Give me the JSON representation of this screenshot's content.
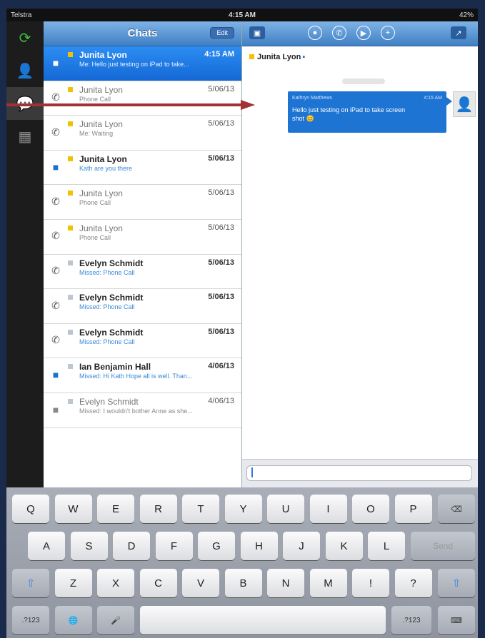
{
  "status": {
    "carrier": "Telstra",
    "time": "4:15 AM",
    "battery": "42%"
  },
  "rail": [
    {
      "name": "sync-icon",
      "glyph": "⟳"
    },
    {
      "name": "contacts-icon",
      "glyph": "👤"
    },
    {
      "name": "chats-icon",
      "glyph": "💬"
    },
    {
      "name": "calendar-icon",
      "glyph": "▦"
    }
  ],
  "list": {
    "title": "Chats",
    "edit_label": "Edit",
    "rows": [
      {
        "icon": "chat",
        "presence": "#f2c200",
        "name": "Junita Lyon",
        "date": "4:15 AM",
        "sub": "Me: Hello just testing on iPad to take...",
        "selected": true,
        "dim": false,
        "subblue": false
      },
      {
        "icon": "phone",
        "presence": "#f2c200",
        "name": "Junita Lyon",
        "date": "5/06/13",
        "sub": "Phone Call",
        "selected": false,
        "dim": true,
        "subblue": false
      },
      {
        "icon": "phone",
        "presence": "#f2c200",
        "name": "Junita Lyon",
        "date": "5/06/13",
        "sub": "Me: Waiting",
        "selected": false,
        "dim": true,
        "subblue": false
      },
      {
        "icon": "chat",
        "presence": "#f2c200",
        "name": "Junita Lyon",
        "date": "5/06/13",
        "sub": "Kath are you there",
        "selected": false,
        "dim": false,
        "subblue": true
      },
      {
        "icon": "phone",
        "presence": "#f2c200",
        "name": "Junita Lyon",
        "date": "5/06/13",
        "sub": "Phone Call",
        "selected": false,
        "dim": true,
        "subblue": false
      },
      {
        "icon": "phone",
        "presence": "#f2c200",
        "name": "Junita Lyon",
        "date": "5/06/13",
        "sub": "Phone Call",
        "selected": false,
        "dim": true,
        "subblue": false
      },
      {
        "icon": "phone",
        "presence": "#bcc6d0",
        "name": "Evelyn Schmidt",
        "date": "5/06/13",
        "sub": "Missed: Phone Call",
        "selected": false,
        "dim": false,
        "subblue": true
      },
      {
        "icon": "phone",
        "presence": "#bcc6d0",
        "name": "Evelyn Schmidt",
        "date": "5/06/13",
        "sub": "Missed: Phone Call",
        "selected": false,
        "dim": false,
        "subblue": true
      },
      {
        "icon": "phone",
        "presence": "#bcc6d0",
        "name": "Evelyn Schmidt",
        "date": "5/06/13",
        "sub": "Missed: Phone Call",
        "selected": false,
        "dim": false,
        "subblue": true
      },
      {
        "icon": "chat",
        "presence": "#bcc6d0",
        "name": "Ian Benjamin Hall",
        "date": "4/06/13",
        "sub": "Missed: Hi Kath Hope all is well. Than...",
        "selected": false,
        "dim": false,
        "subblue": true
      },
      {
        "icon": "chatgray",
        "presence": "#bcc6d0",
        "name": "Evelyn Schmidt",
        "date": "4/06/13",
        "sub": "Missed: I wouldn't bother Anne as she...",
        "selected": false,
        "dim": true,
        "subblue": false
      }
    ]
  },
  "conversation": {
    "contact": "Junita Lyon",
    "message": {
      "sender": "Kathryn Matthews",
      "time": "4:15 AM",
      "text": "Hello just testing on iPad to take screen shot 😊"
    },
    "input_value": ""
  },
  "keyboard": {
    "row1": [
      "Q",
      "W",
      "E",
      "R",
      "T",
      "Y",
      "U",
      "I",
      "O",
      "P"
    ],
    "row2": [
      "A",
      "S",
      "D",
      "F",
      "G",
      "H",
      "J",
      "K",
      "L"
    ],
    "row3": [
      "Z",
      "X",
      "C",
      "V",
      "B",
      "N",
      "M",
      "!",
      "?"
    ],
    "row3_alt": [
      ",",
      "."
    ],
    "send": "Send",
    "num": ".?123"
  },
  "colors": {
    "accent": "#1e74d3",
    "annotation_arrow": "#a33236"
  }
}
